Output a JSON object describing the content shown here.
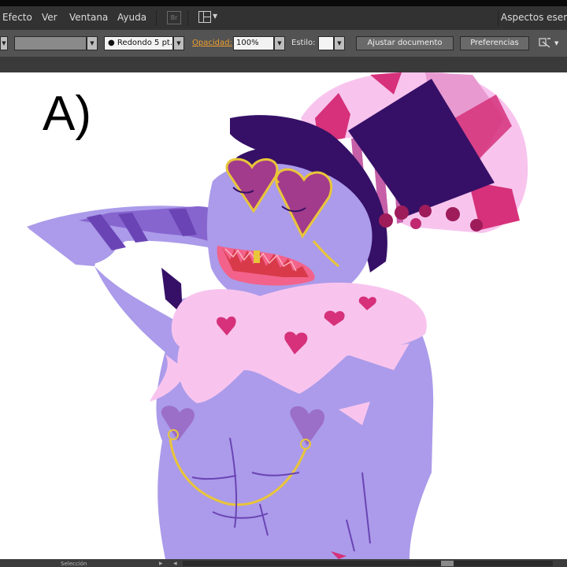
{
  "menubar": {
    "items": [
      "Efecto",
      "Ver",
      "Ventana",
      "Ayuda"
    ],
    "bridge_icon": "Br",
    "workspace_label": "Aspectos esenciales"
  },
  "controlbar": {
    "brush_value": "Redondo 5 pt.",
    "opacity_label": "Opacidad:",
    "opacity_value": "100%",
    "style_label": "Estilo:",
    "adjust_document_button": "Ajustar documento",
    "preferences_button": "Preferencias"
  },
  "canvas": {
    "panel_label": "A)"
  },
  "statusbar": {
    "tool_label": "Selección"
  },
  "colors": {
    "menubar_bg": "#323232",
    "controlbar_bg": "#535353",
    "opacity_label_color": "#f0a030",
    "skin": "#ab9bea",
    "skin_shadow": "#6a44b4",
    "hat_purple": "#351066",
    "fur_pink": "#f8c4ee",
    "heart_magenta": "#d6317a",
    "gold": "#e9c53a"
  },
  "icons": [
    "bridge-icon",
    "workspace-layout-icon",
    "chevron-down-icon",
    "isolate-mode-icon"
  ]
}
